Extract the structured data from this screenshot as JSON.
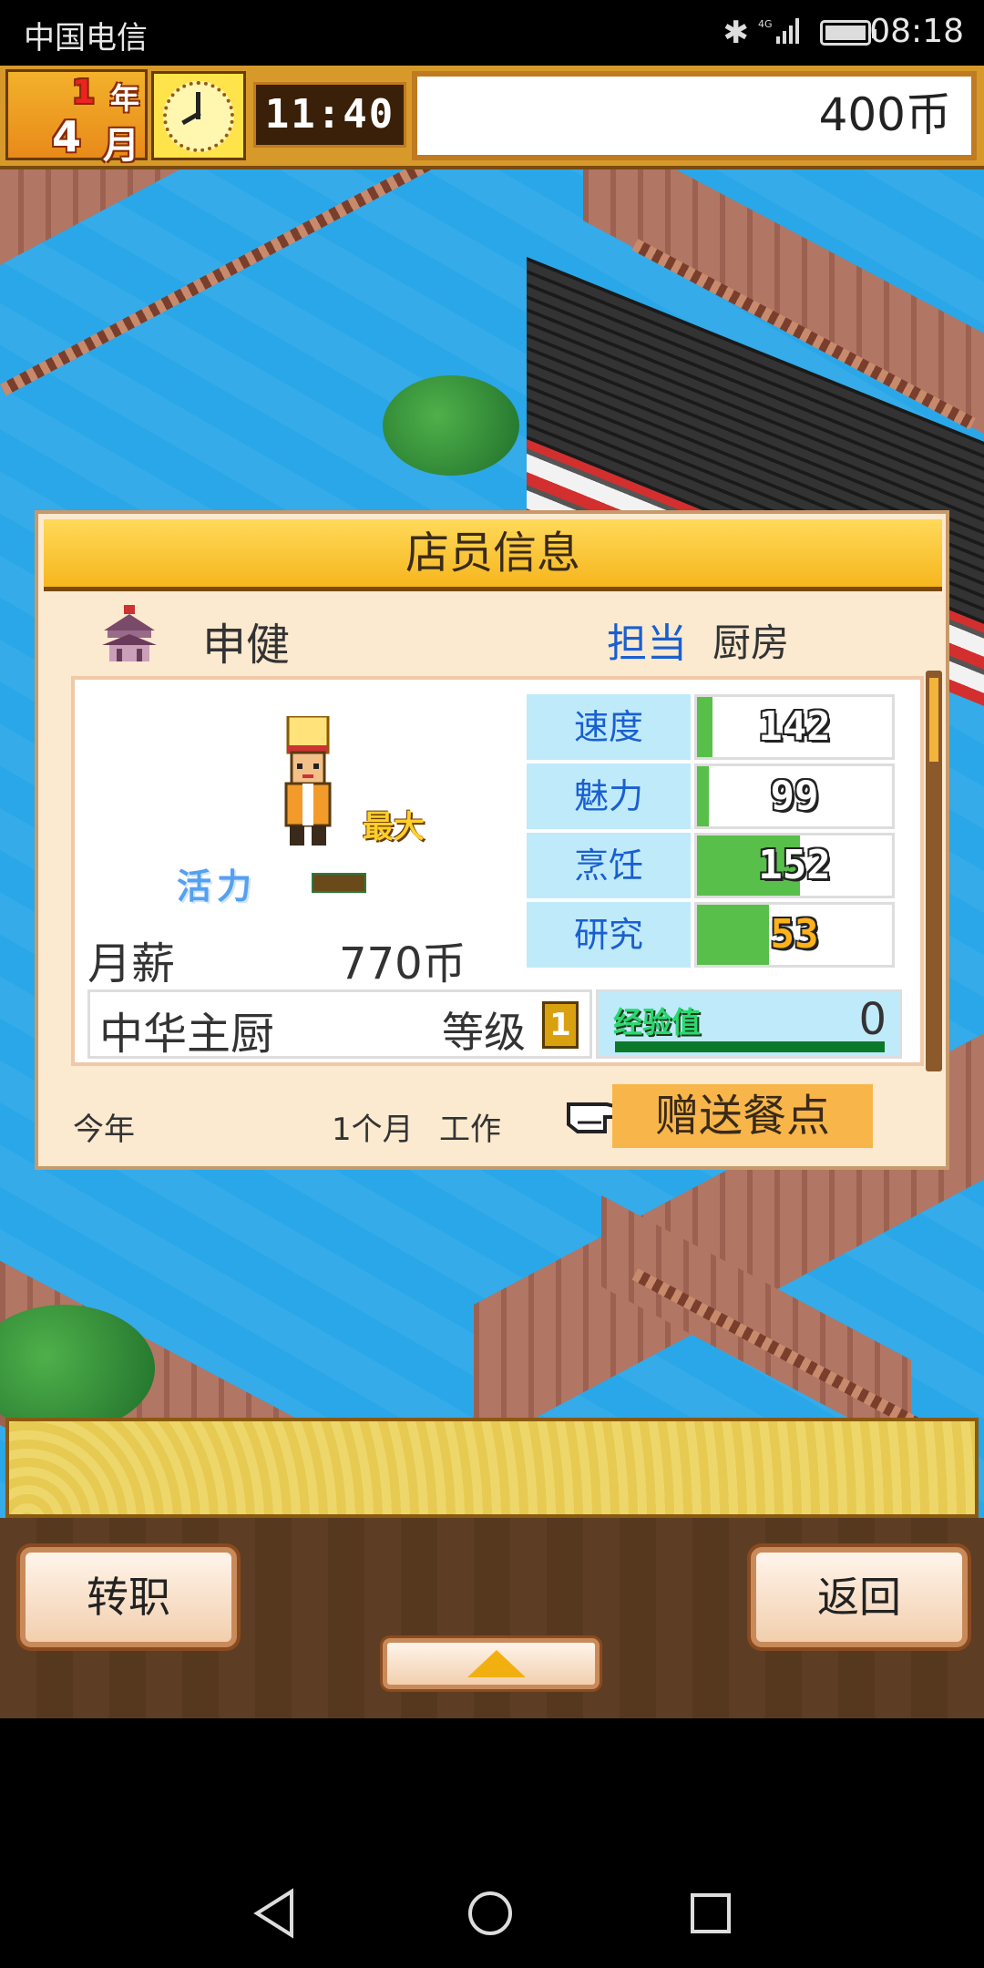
{
  "status_bar": {
    "carrier": "中国电信",
    "time": "08:18",
    "icons": [
      "bluetooth-icon",
      "4g-signal-icon",
      "battery-icon"
    ]
  },
  "hud": {
    "year_number": "1",
    "year_label": "年",
    "month_number": "4",
    "month_label": "月",
    "time": "11:40",
    "money": "400币"
  },
  "dialog": {
    "title": "店员信息",
    "staff_name": "申健",
    "role_label": "担当",
    "role_value": "厨房",
    "max_tag": "最大",
    "vitality_label": "活力",
    "salary_label": "月薪",
    "salary_value": "770币",
    "stats": [
      {
        "label": "速度",
        "value": "142",
        "fill": 0.08,
        "style": "white"
      },
      {
        "label": "魅力",
        "value": "99",
        "fill": 0.06,
        "style": "white"
      },
      {
        "label": "烹饪",
        "value": "152",
        "fill": 0.53,
        "style": "white"
      },
      {
        "label": "研究",
        "value": "53",
        "fill": 0.37,
        "style": "gold"
      }
    ],
    "class_name": "中华主厨",
    "level_label": "等级",
    "level_value": "1",
    "exp_label": "经验值",
    "exp_value": "0",
    "year_label": "今年",
    "work_months": "1个月",
    "work_label": "工作",
    "gift_button": "赠送餐点"
  },
  "bottom_menu": {
    "job_change": "转职",
    "back": "返回"
  },
  "colors": {
    "accent_gold": "#f6b61d",
    "stat_label_bg": "#bfeafa",
    "stat_fill": "#58c04a",
    "role_blue": "#1a5fd0",
    "water": "#2aa7e8"
  }
}
